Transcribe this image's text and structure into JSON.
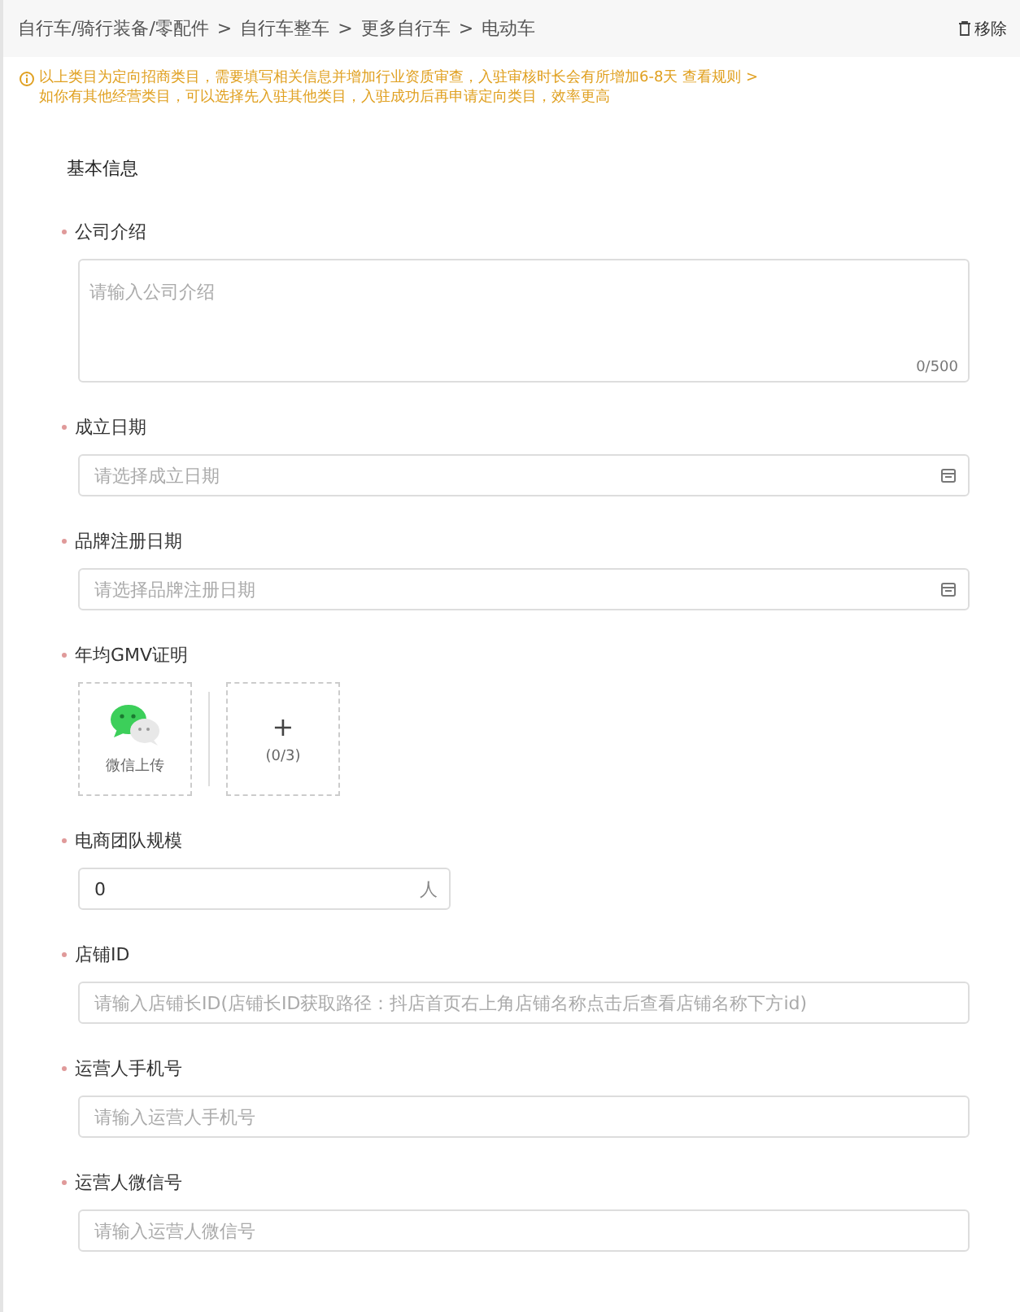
{
  "breadcrumb": [
    "自行车/骑行装备/零配件",
    "自行车整车",
    "更多自行车",
    "电动车"
  ],
  "breadcrumb_separator": ">",
  "remove_button": {
    "label": "移除"
  },
  "notice": {
    "line_1": "以上类目为定向招商类目，需要填写相关信息并增加行业资质审查，入驻审核时长会有所增加6-8天",
    "link": "查看规则 >",
    "line_2": "如你有其他经营类目，可以选择先入驻其他类目，入驻成功后再申请定向类目，效率更高"
  },
  "section_title": "基本信息",
  "fields": [
    {
      "kind": "textarea",
      "label": "公司介绍",
      "required": true,
      "placeholder": "请输入公司介绍",
      "counter": "0/500"
    },
    {
      "kind": "date",
      "label": "成立日期",
      "required": true,
      "placeholder": "请选择成立日期"
    },
    {
      "kind": "date",
      "label": "品牌注册日期",
      "required": true,
      "placeholder": "请选择品牌注册日期"
    },
    {
      "kind": "upload",
      "label": "年均GMV证明",
      "required": true,
      "wechat_label": "微信上传",
      "plus": "+",
      "count": "(0/3)"
    },
    {
      "kind": "number",
      "label": "电商团队规模",
      "required": true,
      "value": "0",
      "unit": "人"
    },
    {
      "kind": "text",
      "label": "店铺ID",
      "required": true,
      "placeholder": "请输入店铺长ID(店铺长ID获取路径：抖店首页右上角店铺名称点击后查看店铺名称下方id)"
    },
    {
      "kind": "text",
      "label": "运营人手机号",
      "required": true,
      "placeholder": "请输入运营人手机号"
    },
    {
      "kind": "text",
      "label": "运营人微信号",
      "required": true,
      "placeholder": "请输入运营人微信号"
    }
  ]
}
